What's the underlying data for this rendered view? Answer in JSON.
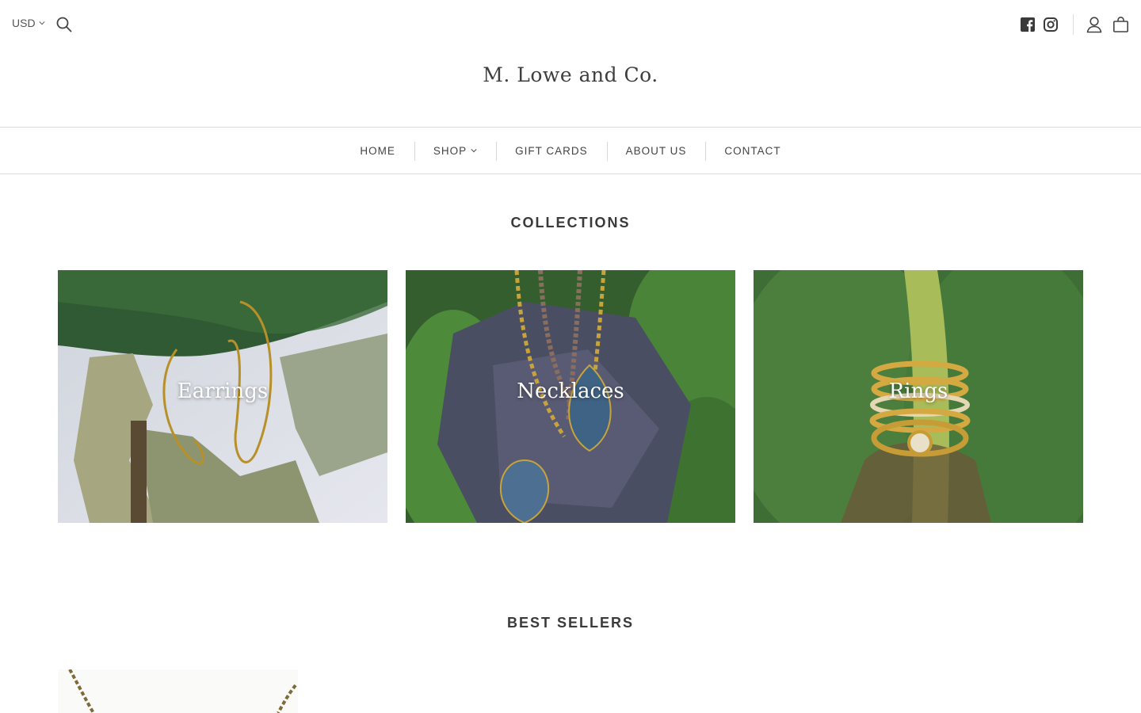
{
  "topbar": {
    "currency": "USD"
  },
  "brand": {
    "name": "M. Lowe and Co."
  },
  "nav": {
    "items": [
      "HOME",
      "SHOP",
      "GIFT CARDS",
      "ABOUT US",
      "CONTACT"
    ]
  },
  "collections": {
    "title": "COLLECTIONS",
    "items": [
      {
        "label": "Earrings"
      },
      {
        "label": "Necklaces"
      },
      {
        "label": "Rings"
      }
    ]
  },
  "best_sellers": {
    "title": "BEST SELLERS"
  },
  "icons": {
    "currency_chevron": "chevron-down-icon",
    "search": "search-icon",
    "facebook": "facebook-icon",
    "instagram": "instagram-icon",
    "account": "account-icon",
    "cart": "cart-icon",
    "shop_chevron": "chevron-down-icon"
  },
  "colors": {
    "text": "#3f3f3f",
    "divider": "#dadada",
    "leaf_green": "#3f6e34"
  }
}
